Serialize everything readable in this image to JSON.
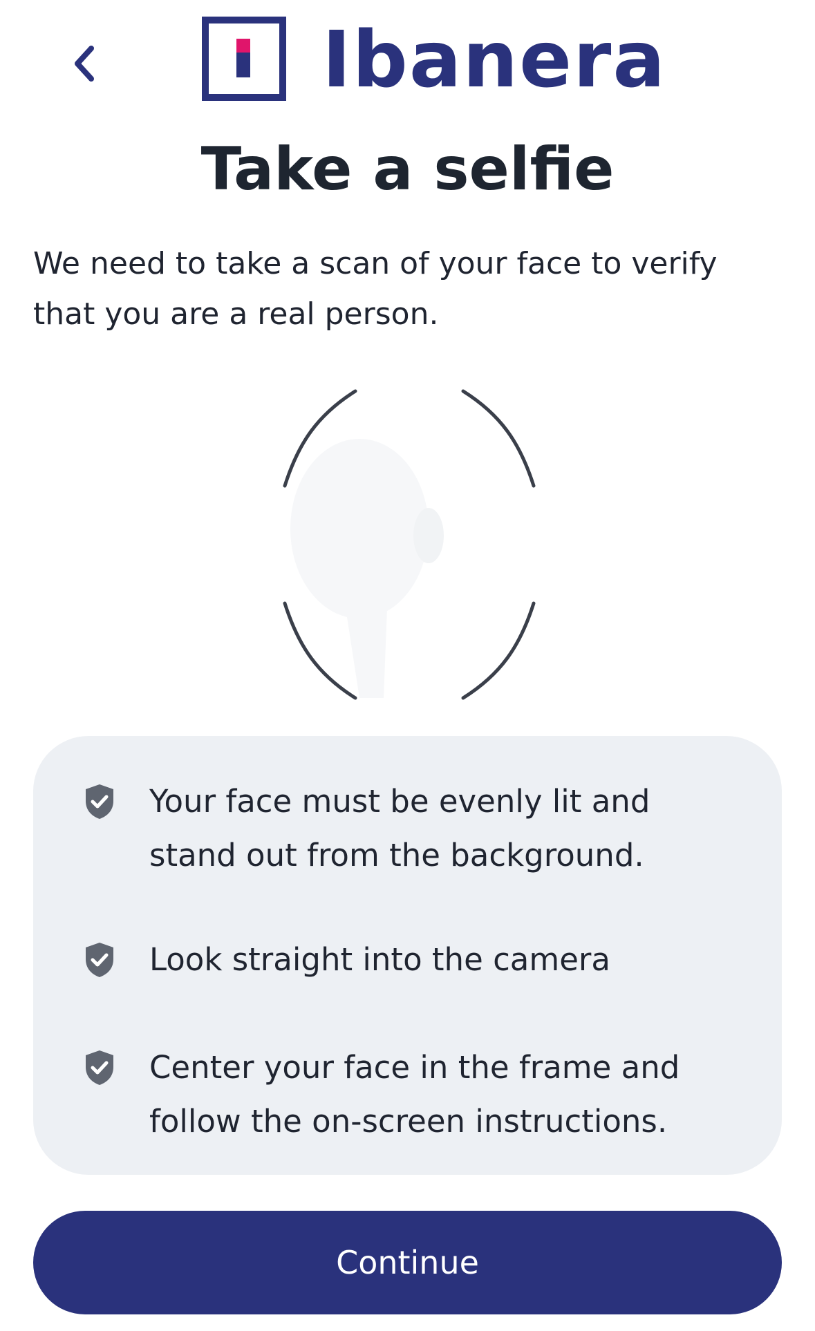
{
  "colors": {
    "brand": "#2a327c",
    "brand_accent": "#e0156b",
    "title": "#1e2530",
    "text": "#1f2430",
    "card_bg": "#edf0f4",
    "icon": "#5f6570",
    "frame_stroke": "#3a3f4a"
  },
  "header": {
    "back_icon": "chevron-left-icon",
    "logo_text": "Ibanera"
  },
  "main": {
    "title": "Take a selfie",
    "description": "We need to take a scan of your face to verify that you are a real person."
  },
  "tips": [
    {
      "icon": "shield-check-icon",
      "text": "Your face must be evenly lit and stand out from the background."
    },
    {
      "icon": "shield-check-icon",
      "text": "Look straight into the camera"
    },
    {
      "icon": "shield-check-icon",
      "text": "Center your face in the frame and follow the on-screen instructions."
    }
  ],
  "footer": {
    "continue_label": "Continue"
  }
}
